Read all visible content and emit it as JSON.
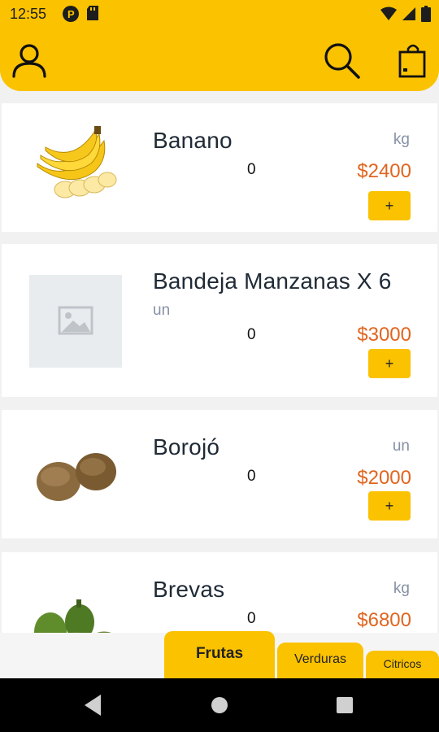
{
  "status_bar": {
    "time": "12:55"
  },
  "header": {
    "profile_icon": "user-icon",
    "search_icon": "search-icon",
    "cart_icon": "shopping-bag-icon"
  },
  "products": [
    {
      "name": "Banano",
      "unit": "kg",
      "quantity": "0",
      "price": "$2400",
      "add_label": "+",
      "image": "bananas"
    },
    {
      "name": "Bandeja Manzanas X 6",
      "unit": "un",
      "quantity": "0",
      "price": "$3000",
      "add_label": "+",
      "image": "placeholder-image-icon"
    },
    {
      "name": "Borojó",
      "unit": "un",
      "quantity": "0",
      "price": "$2000",
      "add_label": "+",
      "image": "borojo"
    },
    {
      "name": "Brevas",
      "unit": "kg",
      "quantity": "0",
      "price": "$6800",
      "add_label": "+",
      "image": "figs"
    }
  ],
  "tabs": [
    {
      "label": "Frutas",
      "selected": true
    },
    {
      "label": "Verduras",
      "selected": false
    },
    {
      "label": "Citricos",
      "selected": false
    }
  ],
  "colors": {
    "accent": "#fbc200",
    "price": "#e0651f",
    "unit": "#8691a6"
  }
}
